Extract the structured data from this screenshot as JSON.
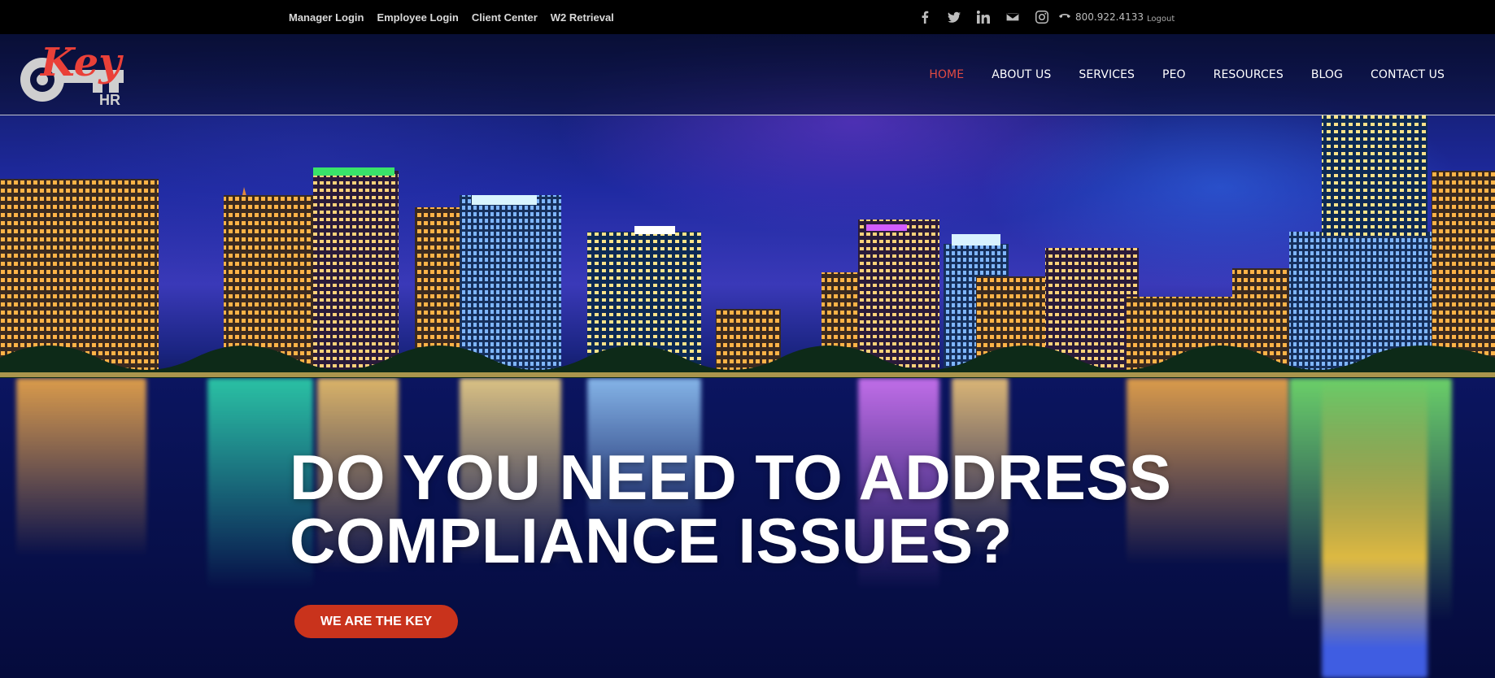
{
  "topbar": {
    "links": [
      {
        "label": "Manager Login"
      },
      {
        "label": "Employee Login"
      },
      {
        "label": "Client Center"
      },
      {
        "label": "W2 Retrieval"
      }
    ],
    "social_icons": [
      "facebook-icon",
      "twitter-icon",
      "linkedin-icon",
      "email-icon",
      "instagram-icon"
    ],
    "phone": "800.922.4133",
    "logout": "Logout"
  },
  "header": {
    "logo": {
      "text_main": "Key",
      "text_sub": "HR"
    },
    "nav": [
      {
        "label": "HOME",
        "active": true
      },
      {
        "label": "ABOUT US",
        "active": false
      },
      {
        "label": "SERVICES",
        "active": false
      },
      {
        "label": "PEO",
        "active": false
      },
      {
        "label": "RESOURCES",
        "active": false
      },
      {
        "label": "BLOG",
        "active": false
      },
      {
        "label": "CONTACT US",
        "active": false
      }
    ]
  },
  "hero": {
    "headline_line1": "DO YOU NEED TO ADDRESS",
    "headline_line2": "COMPLIANCE ISSUES?",
    "cta_label": "WE ARE THE KEY"
  },
  "colors": {
    "accent": "#e14a43",
    "cta": "#c9331c",
    "topbar_bg": "#000000"
  }
}
